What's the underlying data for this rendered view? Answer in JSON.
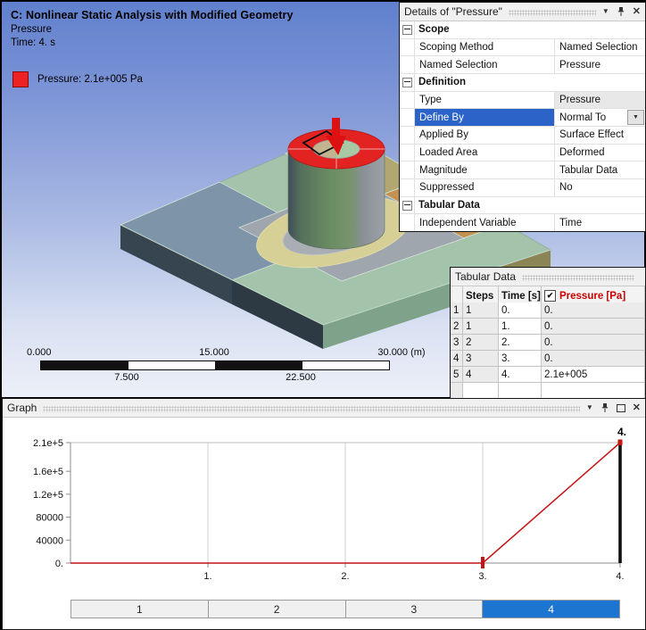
{
  "viewport": {
    "title": "C: Nonlinear Static Analysis with Modified Geometry",
    "subtitle": "Pressure",
    "time_label": "Time: 4. s",
    "legend": {
      "swatch_color": "#EE2222",
      "label": "Pressure: 2.1e+005 Pa"
    },
    "ruler": {
      "top_labels": [
        "0.000",
        "15.000",
        "30.000 (m)"
      ],
      "bottom_labels": [
        "7.500",
        "22.500"
      ],
      "segment_colors": [
        "#111111",
        "#ffffff",
        "#111111",
        "#ffffff"
      ]
    }
  },
  "details_panel": {
    "title": "Details of \"Pressure\"",
    "rows": [
      {
        "type": "group",
        "label": "Scope"
      },
      {
        "type": "prop",
        "label": "Scoping Method",
        "value": "Named Selection"
      },
      {
        "type": "prop",
        "label": "Named Selection",
        "value": "Pressure"
      },
      {
        "type": "group",
        "label": "Definition"
      },
      {
        "type": "prop",
        "label": "Type",
        "value": "Pressure",
        "readonly": true
      },
      {
        "type": "prop",
        "label": "Define By",
        "value": "Normal To",
        "selected": true,
        "dropdown": true
      },
      {
        "type": "prop",
        "label": "Applied By",
        "value": "Surface Effect"
      },
      {
        "type": "prop",
        "label": "Loaded Area",
        "value": "Deformed"
      },
      {
        "type": "prop",
        "label": "Magnitude",
        "value": "Tabular Data"
      },
      {
        "type": "prop",
        "label": "Suppressed",
        "value": "No"
      },
      {
        "type": "group",
        "label": "Tabular Data"
      },
      {
        "type": "prop",
        "label": "Independent Variable",
        "value": "Time"
      }
    ]
  },
  "tabular_panel": {
    "title": "Tabular Data",
    "columns": [
      "",
      "Steps",
      "Time [s]",
      "Pressure [Pa]"
    ],
    "pressure_checked": true,
    "rows": [
      {
        "index": "1",
        "steps": "1",
        "time": "0.",
        "pressure": "0.",
        "pressure_bg": "gray"
      },
      {
        "index": "2",
        "steps": "1",
        "time": "1.",
        "pressure": "0.",
        "pressure_bg": "gray"
      },
      {
        "index": "3",
        "steps": "2",
        "time": "2.",
        "pressure": "0.",
        "pressure_bg": "gray"
      },
      {
        "index": "4",
        "steps": "3",
        "time": "3.",
        "pressure": "0.",
        "pressure_bg": "gray"
      },
      {
        "index": "5",
        "steps": "4",
        "time": "4.",
        "pressure": "2.1e+005",
        "pressure_bg": "white"
      }
    ]
  },
  "graph_panel": {
    "title": "Graph"
  },
  "chart_data": {
    "type": "line",
    "x": [
      0,
      1,
      2,
      3,
      4
    ],
    "series": [
      {
        "name": "Pressure [Pa]",
        "values": [
          0,
          0,
          0,
          0,
          210000
        ],
        "color": "#c41414"
      }
    ],
    "xlim": [
      0,
      4
    ],
    "ylim": [
      0,
      210000
    ],
    "x_ticks": [
      1,
      2,
      3,
      4
    ],
    "x_tick_labels": [
      "1.",
      "2.",
      "3.",
      "4."
    ],
    "x_gridlines": [
      1,
      2,
      3
    ],
    "y_ticks": [
      0,
      40000,
      80000,
      120000,
      160000,
      210000
    ],
    "y_tick_labels": [
      "0.",
      "40000",
      "80000",
      "1.2e+5",
      "1.6e+5",
      "2.1e+5"
    ],
    "grid": "partial",
    "legend_position": "none",
    "annotations": {
      "current_step_label": "4.",
      "current_step_x": 4,
      "start_tick_x": 3,
      "end_bar_color": "#111111"
    },
    "steps_bar": {
      "labels": [
        "1",
        "2",
        "3",
        "4"
      ],
      "active": "4",
      "active_color": "#1b75d1"
    }
  },
  "icons": {
    "collapse": "▼",
    "close": "✕",
    "check": "✔",
    "combo_arrow": "▼"
  },
  "colors": {
    "selected_row": "#2b63c9",
    "series_red": "#c41414",
    "pressure_header_red": "#cc0000",
    "step_active_blue": "#1b75d1"
  }
}
